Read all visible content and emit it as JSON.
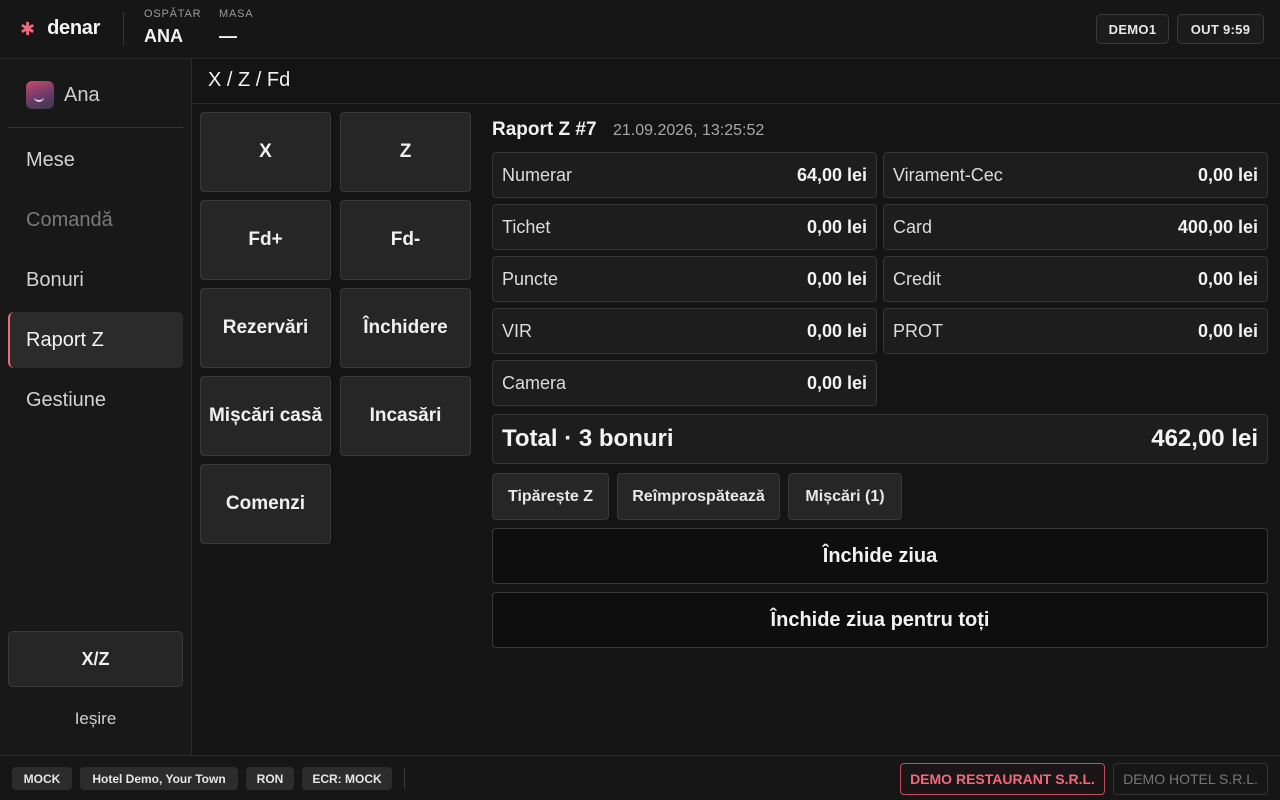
{
  "header": {
    "logo_mark": "✱",
    "app_name": "denar",
    "waiter_label": "OSPĂTAR",
    "waiter_value": "ANA",
    "table_label": "MASA",
    "table_value": "—",
    "device_badge": "DEMO1",
    "out_badge": "OUT 9:59"
  },
  "sidebar": {
    "user_name": "Ana",
    "items": [
      {
        "label": "Mese"
      },
      {
        "label": "Comandă"
      },
      {
        "label": "Bonuri"
      },
      {
        "label": "Raport Z"
      },
      {
        "label": "Gestiune"
      }
    ],
    "xz_button": "X/Z",
    "exit_label": "Ieșire"
  },
  "main": {
    "title": "X / Z / Fd",
    "grid_buttons": [
      "X",
      "Z",
      "Fd+",
      "Fd-",
      "Rezervări",
      "Închidere",
      "Mișcări casă",
      "Incasări",
      "Comenzi"
    ],
    "report": {
      "title": "Raport Z #7",
      "datetime": "21.09.2026, 13:25:52",
      "rows": [
        {
          "label": "Numerar",
          "amount": "64,00 lei"
        },
        {
          "label": "Virament-Cec",
          "amount": "0,00 lei"
        },
        {
          "label": "Tichet",
          "amount": "0,00 lei"
        },
        {
          "label": "Card",
          "amount": "400,00 lei"
        },
        {
          "label": "Puncte",
          "amount": "0,00 lei"
        },
        {
          "label": "Credit",
          "amount": "0,00 lei"
        },
        {
          "label": "VIR",
          "amount": "0,00 lei"
        },
        {
          "label": "PROT",
          "amount": "0,00 lei"
        },
        {
          "label": "Camera",
          "amount": "0,00 lei"
        }
      ],
      "total_label": "Total · 3 bonuri",
      "total_amount": "462,00 lei"
    },
    "actions": {
      "print_z": "Tipărește Z",
      "refresh": "Reîmprospătează",
      "movements": "Mișcări (1)"
    },
    "close_day": "Închide ziua",
    "close_day_all": "Închide ziua pentru toți"
  },
  "footer": {
    "mode": "MOCK",
    "location": "Hotel Demo, Your Town",
    "currency": "RON",
    "ecr": "ECR: MOCK",
    "company_active": "DEMO RESTAURANT S.R.L.",
    "company_inactive": "DEMO HOTEL S.R.L."
  },
  "colors": {
    "accent": "#f06a7e",
    "background": "#141414",
    "surface": "#262626"
  }
}
